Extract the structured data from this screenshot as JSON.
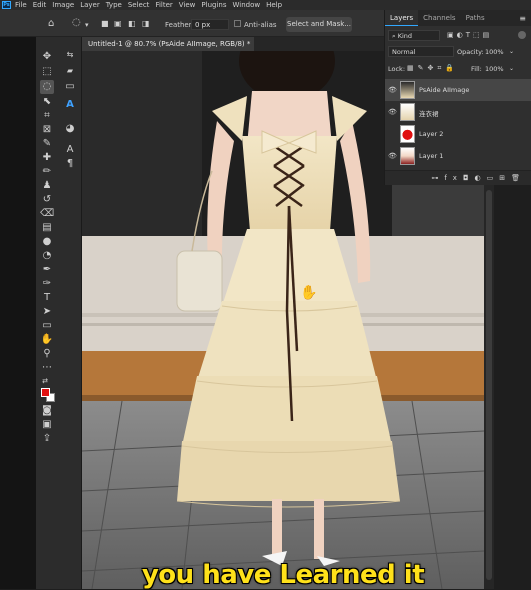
{
  "menubar": {
    "app_icon": "Ps",
    "items": [
      "File",
      "Edit",
      "Image",
      "Layer",
      "Type",
      "Select",
      "Filter",
      "View",
      "Plugins",
      "Window",
      "Help"
    ]
  },
  "options": {
    "feather_label": "Feather:",
    "feather_value": "0 px",
    "antialias_label": "Anti-alias",
    "select_mask_label": "Select and Mask..."
  },
  "document": {
    "tab_title": "Untitled-1 @ 80.7% (PsAide AIImage, RGB/8) *",
    "close": "×"
  },
  "layers_panel": {
    "tabs": [
      "Layers",
      "Channels",
      "Paths"
    ],
    "filter_kind": "Kind",
    "blend_mode": "Normal",
    "opacity_label": "Opacity:",
    "opacity_value": "100%",
    "lock_label": "Lock:",
    "fill_label": "Fill:",
    "fill_value": "100%",
    "layers": [
      {
        "name": "PsAide AIImage",
        "selected": true,
        "visible": true
      },
      {
        "name": "连衣裙",
        "selected": false,
        "visible": true
      },
      {
        "name": "Layer 2",
        "selected": false,
        "visible": false
      },
      {
        "name": "Layer 1",
        "selected": false,
        "visible": true
      }
    ]
  },
  "canvas": {
    "caption": "you have Learned it"
  },
  "colors": {
    "accent": "#31a8ff",
    "caption": "#ffe11a",
    "foreground_swatch": "#e01010",
    "background_swatch": "#ffffff"
  }
}
